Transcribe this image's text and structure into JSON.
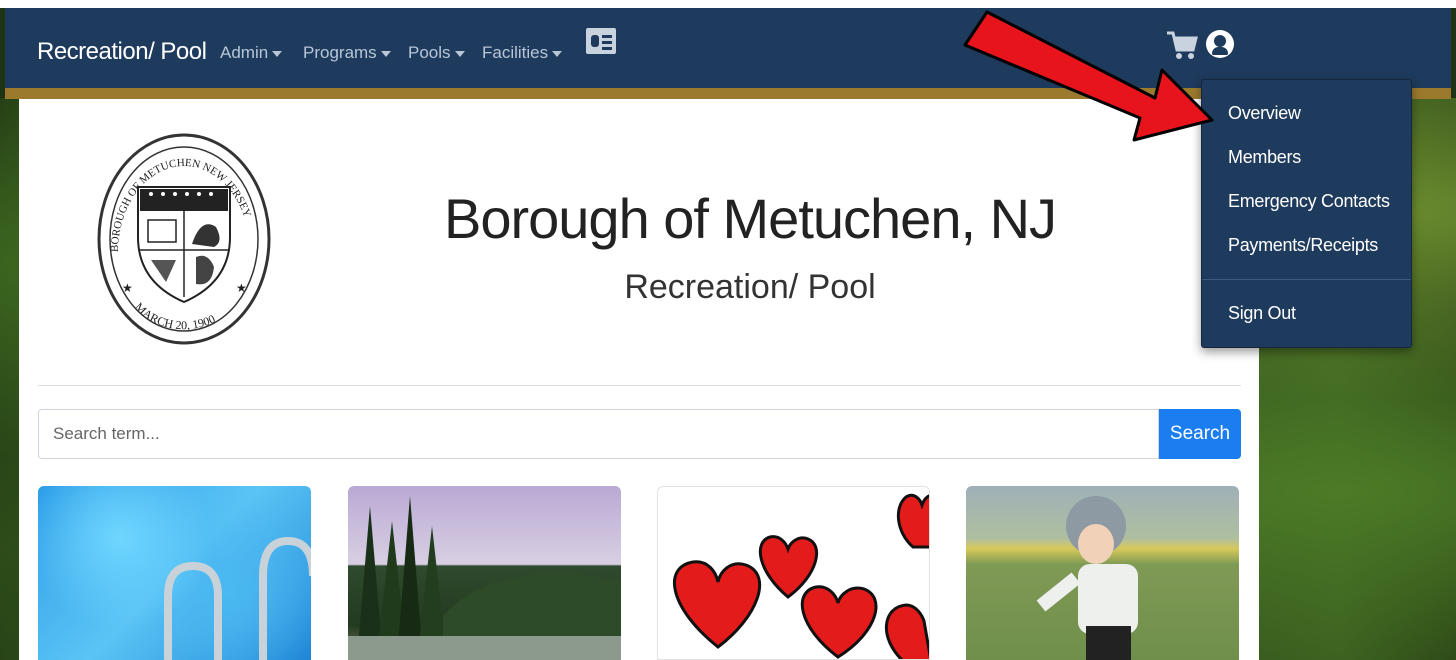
{
  "navbar": {
    "brand": "Recreation/ Pool",
    "menus": [
      {
        "label": "Admin"
      },
      {
        "label": "Programs"
      },
      {
        "label": "Pools"
      },
      {
        "label": "Facilities"
      }
    ],
    "icons": [
      "id-card-icon",
      "shopping-cart-icon",
      "user-circle-icon"
    ]
  },
  "header": {
    "title": "Borough of Metuchen, NJ",
    "subtitle": "Recreation/ Pool",
    "seal_text": "BOROUGH OF METUCHEN NEW JERSEY",
    "seal_date": "MARCH 20, 1900"
  },
  "search": {
    "placeholder": "Search term...",
    "button": "Search"
  },
  "user_menu": {
    "items": [
      {
        "label": "Overview"
      },
      {
        "label": "Members"
      },
      {
        "label": "Emergency Contacts"
      },
      {
        "label": "Payments/Receipts"
      }
    ],
    "sign_out": "Sign Out"
  },
  "colors": {
    "navbar": "#1e3a5c",
    "accent_border": "#9b7a2e",
    "search_button": "#1a7df0",
    "annotation_arrow": "#e8141b"
  }
}
